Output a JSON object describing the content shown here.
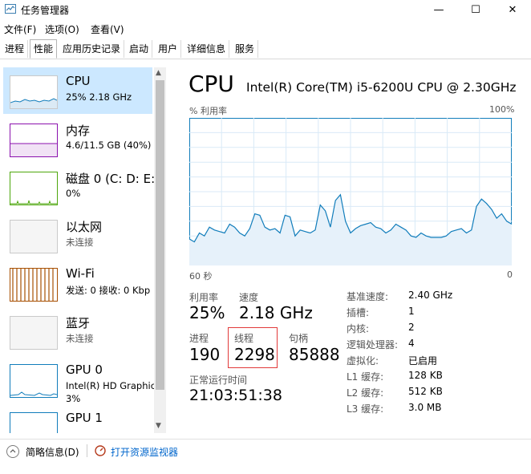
{
  "window": {
    "title": "任务管理器",
    "minimize": "—",
    "maximize": "☐",
    "close": "✕"
  },
  "menu": [
    "文件(F)",
    "选项(O)",
    "查看(V)"
  ],
  "tabs": [
    "进程",
    "性能",
    "应用历史记录",
    "启动",
    "用户",
    "详细信息",
    "服务"
  ],
  "active_tab": "性能",
  "resources": [
    {
      "name": "CPU",
      "sub": "25% 2.18 GHz",
      "sub2": ""
    },
    {
      "name": "内存",
      "sub": "4.6/11.5 GB (40%)",
      "sub2": ""
    },
    {
      "name": "磁盘 0 (C: D: E:",
      "sub": "0%",
      "sub2": ""
    },
    {
      "name": "以太网",
      "sub": "未连接",
      "sub2": ""
    },
    {
      "name": "Wi-Fi",
      "sub": "发送: 0 接收: 0 Kbp",
      "sub2": ""
    },
    {
      "name": "蓝牙",
      "sub": "未连接",
      "sub2": ""
    },
    {
      "name": "GPU 0",
      "sub": "Intel(R) HD Graphic",
      "sub2": "3%"
    },
    {
      "name": "GPU 1",
      "sub": "",
      "sub2": ""
    }
  ],
  "colors": {
    "cpu": "#117dbb",
    "memory": "#8b12ae",
    "disk": "#4da60c",
    "wifi": "#a74f01",
    "gpu": "#117dbb",
    "highlight": "#e23a3a",
    "link": "#0066cc"
  },
  "main": {
    "heading": "CPU",
    "model": "Intel(R) Core(TM) i5-6200U CPU @ 2.30GHz",
    "graph_label": "% 利用率",
    "graph_max": "100%",
    "graph_time": "60 秒",
    "graph_min": "0"
  },
  "cpu_history": [
    18,
    16,
    22,
    20,
    26,
    24,
    23,
    22,
    28,
    26,
    22,
    20,
    25,
    35,
    34,
    26,
    24,
    25,
    22,
    34,
    33,
    20,
    24,
    23,
    22,
    24,
    41,
    37,
    26,
    44,
    48,
    30,
    22,
    25,
    27,
    28,
    29,
    26,
    25,
    22,
    24,
    28,
    26,
    24,
    20,
    19,
    22,
    20,
    19,
    19,
    19,
    20,
    23,
    24,
    25,
    22,
    24,
    40,
    45,
    42,
    38,
    32,
    35,
    30,
    28
  ],
  "stats": {
    "utilization_label": "利用率",
    "utilization": "25%",
    "speed_label": "速度",
    "speed": "2.18 GHz",
    "processes_label": "进程",
    "processes": "190",
    "threads_label": "线程",
    "threads": "2298",
    "handles_label": "句柄",
    "handles": "85888",
    "uptime_label": "正常运行时间",
    "uptime": "21:03:51:38"
  },
  "specs": [
    {
      "label": "基准速度:",
      "value": "2.40 GHz"
    },
    {
      "label": "插槽:",
      "value": "1"
    },
    {
      "label": "内核:",
      "value": "2"
    },
    {
      "label": "逻辑处理器:",
      "value": "4"
    },
    {
      "label": "虚拟化:",
      "value": "已启用"
    },
    {
      "label": "L1 缓存:",
      "value": "128 KB"
    },
    {
      "label": "L2 缓存:",
      "value": "512 KB"
    },
    {
      "label": "L3 缓存:",
      "value": "3.0 MB"
    }
  ],
  "footer": {
    "collapse": "简略信息(D)",
    "monitor": "打开资源监视器"
  }
}
